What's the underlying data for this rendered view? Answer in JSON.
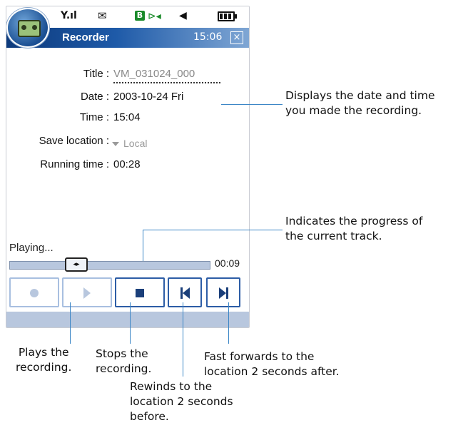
{
  "statusbar": {
    "signal_text": "Y.ıl",
    "message_icon": "✉",
    "bt_label": "B",
    "bt_symbol": "⊳◂",
    "speaker_icon": "◀"
  },
  "header": {
    "title": "Recorder",
    "clock": "15:06",
    "close_icon": "×"
  },
  "fields": {
    "title_label": "Title :",
    "title_value": "VM_031024_000",
    "date_label": "Date :",
    "date_value": "2003-10-24 Fri",
    "time_label": "Time :",
    "time_value": "15:04",
    "save_label": "Save location :",
    "save_value": "Local",
    "running_label": "Running time :",
    "running_value": "00:28"
  },
  "player": {
    "status": "Playing...",
    "elapsed": "00:09",
    "thumb_glyph": "◂▸",
    "progress_fraction": 0.32
  },
  "callouts": {
    "date_time_1": "Displays the date and time",
    "date_time_2": "you made the recording.",
    "progress_1": "Indicates the progress of",
    "progress_2": "the current track.",
    "plays_1": "Plays the",
    "plays_2": "recording.",
    "stops_1": "Stops the",
    "stops_2": "recording.",
    "ff_1": "Fast forwards to the",
    "ff_2": "location 2 seconds after.",
    "rew_1": "Rewinds to the",
    "rew_2": "location 2 seconds",
    "rew_3": "before."
  },
  "colors": {
    "titlebar_dark": "#0d3a7c",
    "button_border": "#2d5da6",
    "callout_line": "#3b86c6",
    "track": "#b8c7de"
  }
}
